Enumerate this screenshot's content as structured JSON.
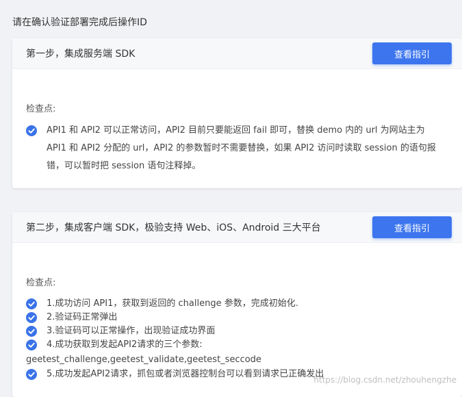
{
  "page": {
    "title": "请在确认验证部署完成后操作ID"
  },
  "steps": [
    {
      "title": "第一步，集成服务端 SDK",
      "button": "查看指引",
      "check_label": "检查点:",
      "items": [
        "API1 和 API2 可以正常访问，API2 目前只要能返回 fail 即可，替换 demo 内的 url 为网站主为API1 和 API2 分配的 url，API2 的参数暂时不需要替换，如果 API2 访问时读取 session 的语句报错，可以暂时把 session 语句注释掉。"
      ]
    },
    {
      "title": "第二步，集成客户端 SDK，极验支持 Web、iOS、Android 三大平台",
      "button": "查看指引",
      "check_label": "检查点:",
      "items": [
        "1.成功访问 API1，获取到返回的 challenge 参数，完成初始化.",
        "2.验证码正常弹出",
        "3.验证码可以正常操作，出现验证成功界面",
        "4.成功获取到发起API2请求的三个参数:",
        "5.成功发起API2请求，抓包或者浏览器控制台可以看到请求已正确发出"
      ],
      "item4_continuation": "geetest_challenge,geetest_validate,geetest_seccode"
    }
  ],
  "watermark": "https://blog.csdn.net/zhouhengzhe",
  "colors": {
    "accent": "#3c75ee",
    "check": "#3a73e8",
    "background": "#f1f2f5"
  },
  "icons": {
    "check": "check-circle-icon"
  }
}
